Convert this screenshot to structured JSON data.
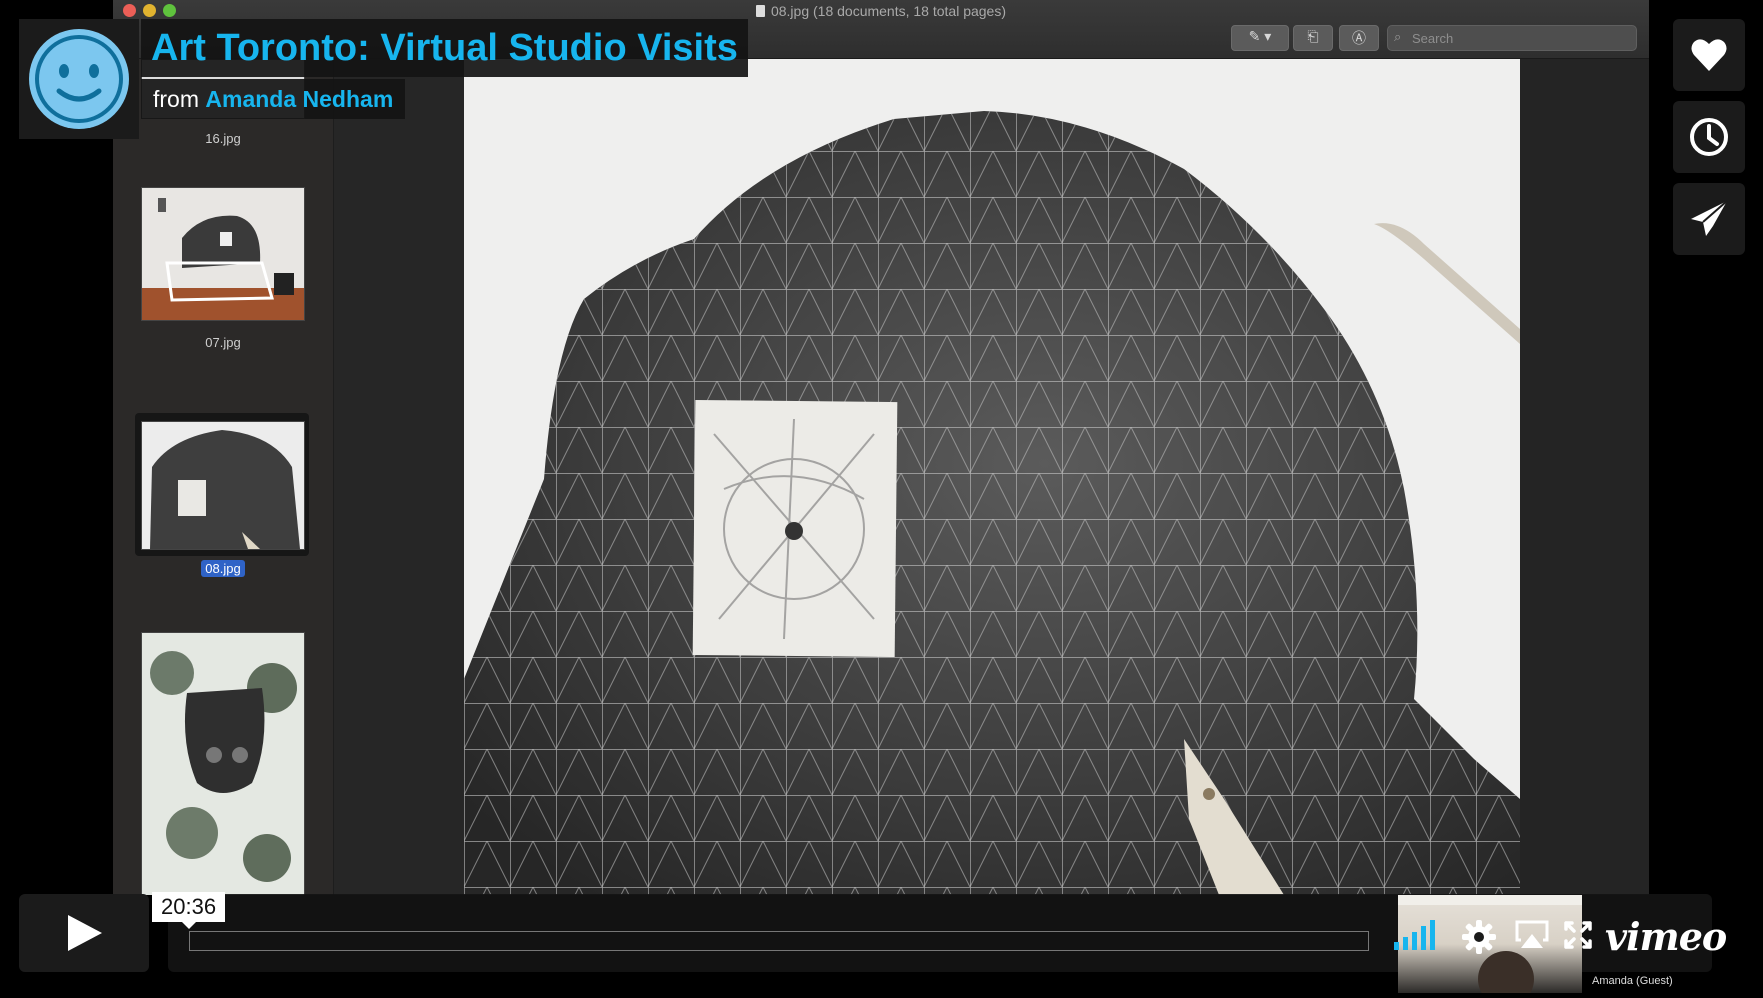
{
  "preview_window": {
    "title": "08.jpg (18 documents, 18 total pages)",
    "search_placeholder": "Search",
    "thumbnails": [
      {
        "name": "16.jpg",
        "selected": false
      },
      {
        "name": "07.jpg",
        "selected": false
      },
      {
        "name": "08.jpg",
        "selected": true
      },
      {
        "name": "",
        "selected": false
      }
    ],
    "current_file": "08.jpg"
  },
  "video": {
    "title": "Art Toronto: Virtual Studio Visits",
    "byline_prefix": "from",
    "author": "Amanda Nedham",
    "current_time": "20:36",
    "progress": 0,
    "brand": "vimeo",
    "guest_label": "Amanda (Guest)",
    "accent_color": "#17b5ee"
  },
  "icons": {
    "like": "heart-icon",
    "watch_later": "clock-icon",
    "share": "paper-plane-icon",
    "play": "play-icon",
    "volume": "volume-bars-icon",
    "settings": "gear-icon",
    "airplay": "airplay-icon",
    "fullscreen": "fullscreen-icon"
  }
}
